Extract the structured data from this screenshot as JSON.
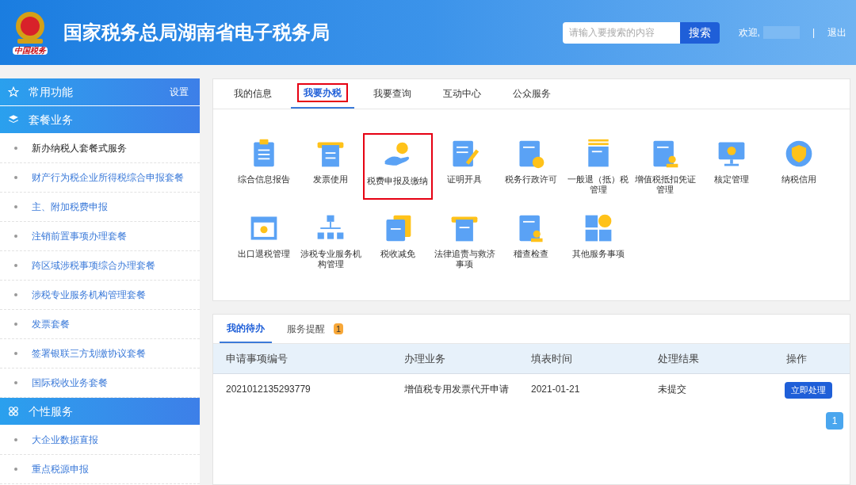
{
  "header": {
    "title": "国家税务总局湖南省电子税务局",
    "logo_text": "中国税务",
    "search": {
      "placeholder": "请输入要搜索的内容",
      "button": "搜索"
    },
    "welcome": "欢迎,",
    "separator": "|",
    "logout": "退出"
  },
  "sidebar": {
    "sections": [
      {
        "kind": "favorites",
        "title": "常用功能",
        "action": "设置"
      },
      {
        "kind": "packages",
        "title": "套餐业务",
        "items": [
          {
            "label": "新办纳税人套餐式服务",
            "selected": true
          },
          {
            "label": "财产行为税企业所得税综合申报套餐",
            "selected": false
          },
          {
            "label": "主、附加税费申报",
            "selected": false
          },
          {
            "label": "注销前置事项办理套餐",
            "selected": false
          },
          {
            "label": "跨区域涉税事项综合办理套餐",
            "selected": false
          },
          {
            "label": "涉税专业服务机构管理套餐",
            "selected": false
          },
          {
            "label": "发票套餐",
            "selected": false
          },
          {
            "label": "签署银联三方划缴协议套餐",
            "selected": false
          },
          {
            "label": "国际税收业务套餐",
            "selected": false
          }
        ]
      },
      {
        "kind": "personal",
        "title": "个性服务",
        "items": [
          {
            "label": "大企业数据直报",
            "selected": false
          },
          {
            "label": "重点税源申报",
            "selected": false
          }
        ]
      }
    ]
  },
  "main_tabs": [
    {
      "label": "我的信息",
      "selected": false,
      "highlighted": false
    },
    {
      "label": "我要办税",
      "selected": true,
      "highlighted": true
    },
    {
      "label": "我要查询",
      "selected": false,
      "highlighted": false
    },
    {
      "label": "互动中心",
      "selected": false,
      "highlighted": false
    },
    {
      "label": "公众服务",
      "selected": false,
      "highlighted": false
    }
  ],
  "services": [
    {
      "label": "综合信息报告",
      "highlighted": false
    },
    {
      "label": "发票使用",
      "highlighted": false
    },
    {
      "label": "税费申报及缴纳",
      "highlighted": true
    },
    {
      "label": "证明开具",
      "highlighted": false
    },
    {
      "label": "税务行政许可",
      "highlighted": false
    },
    {
      "label": "一般退（抵）税管理",
      "highlighted": false
    },
    {
      "label": "增值税抵扣凭证管理",
      "highlighted": false
    },
    {
      "label": "核定管理",
      "highlighted": false
    },
    {
      "label": "纳税信用",
      "highlighted": false
    },
    {
      "label": "出口退税管理",
      "highlighted": false
    },
    {
      "label": "涉税专业服务机构管理",
      "highlighted": false
    },
    {
      "label": "税收减免",
      "highlighted": false
    },
    {
      "label": "法律追责与救济事项",
      "highlighted": false
    },
    {
      "label": "稽查检查",
      "highlighted": false
    },
    {
      "label": "其他服务事项",
      "highlighted": false
    }
  ],
  "todo": {
    "tabs": [
      {
        "label": "我的待办",
        "selected": true
      },
      {
        "label": "服务提醒",
        "selected": false,
        "badge": "1"
      }
    ],
    "table": {
      "columns": [
        "申请事项编号",
        "办理业务",
        "填表时间",
        "处理结果",
        "操作"
      ],
      "rows": [
        {
          "cells": [
            "2021012135293779",
            "增值税专用发票代开申请",
            "2021-01-21",
            "未提交"
          ],
          "action": "立即处理"
        }
      ]
    },
    "pagination": [
      {
        "label": "1",
        "selected": true
      }
    ]
  }
}
